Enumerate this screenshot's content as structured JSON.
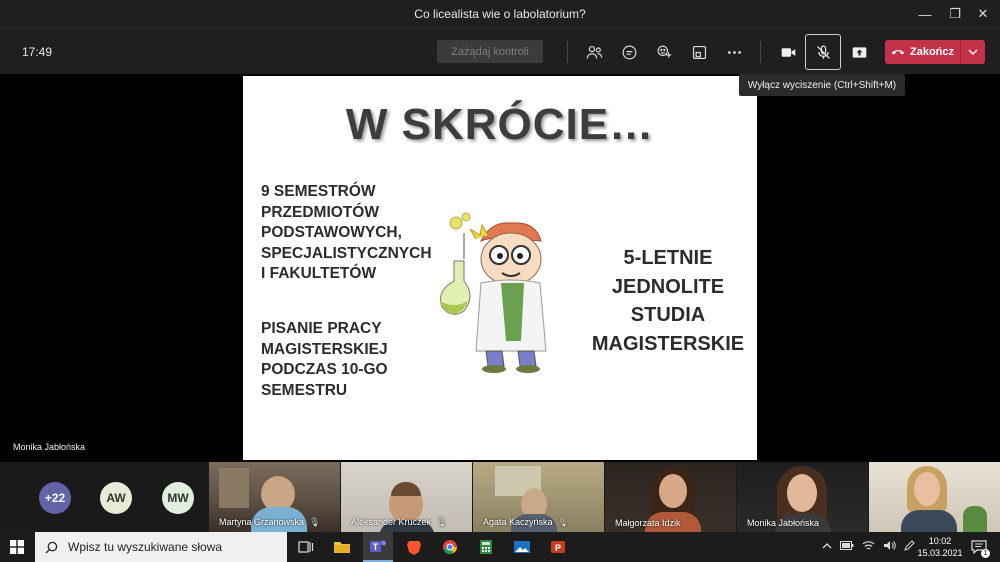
{
  "window": {
    "title": "Co licealista wie o labolatorium?"
  },
  "toolbar": {
    "time": "17:49",
    "request_control": "Zażądaj kontroli",
    "leave": "Zakończ"
  },
  "tooltip": "Wyłącz wyciszenie (Ctrl+Shift+M)",
  "slide": {
    "title": "W SKRÓCIE…",
    "left_block1": [
      "9 SEMESTRÓW",
      "PRZEDMIOTÓW",
      "PODSTAWOWYCH,",
      "SPECJALISTYCZNYCH",
      "I FAKULTETÓW"
    ],
    "left_block2": [
      "PISANIE PRACY",
      "MAGISTERSKIEJ",
      "PODCZAS 10-GO",
      "SEMESTRU"
    ],
    "right_block": [
      "5-LETNIE",
      "JEDNOLITE",
      "STUDIA",
      "MAGISTERSKIE"
    ]
  },
  "presenter_name": "Monika Jabłońska",
  "gallery": {
    "overflow": "+22",
    "avatars": [
      {
        "initials": "AW",
        "color": "#e8ecd6"
      },
      {
        "initials": "MW",
        "color": "#dfeedd"
      }
    ],
    "tiles": [
      {
        "name": "Martyna Grzanowska",
        "muted": true
      },
      {
        "name": "Aleksander Kruczek",
        "muted": true
      },
      {
        "name": "Agata Kaczyńska",
        "muted": true
      },
      {
        "name": "Małgorzata Idzik",
        "muted": false
      },
      {
        "name": "Monika Jabłońska",
        "muted": false
      },
      {
        "name": "",
        "muted": false
      }
    ]
  },
  "taskbar": {
    "search_placeholder": "Wpisz tu wyszukiwane słowa",
    "time": "10:02",
    "date": "15.03.2021",
    "notification_count": "1"
  }
}
